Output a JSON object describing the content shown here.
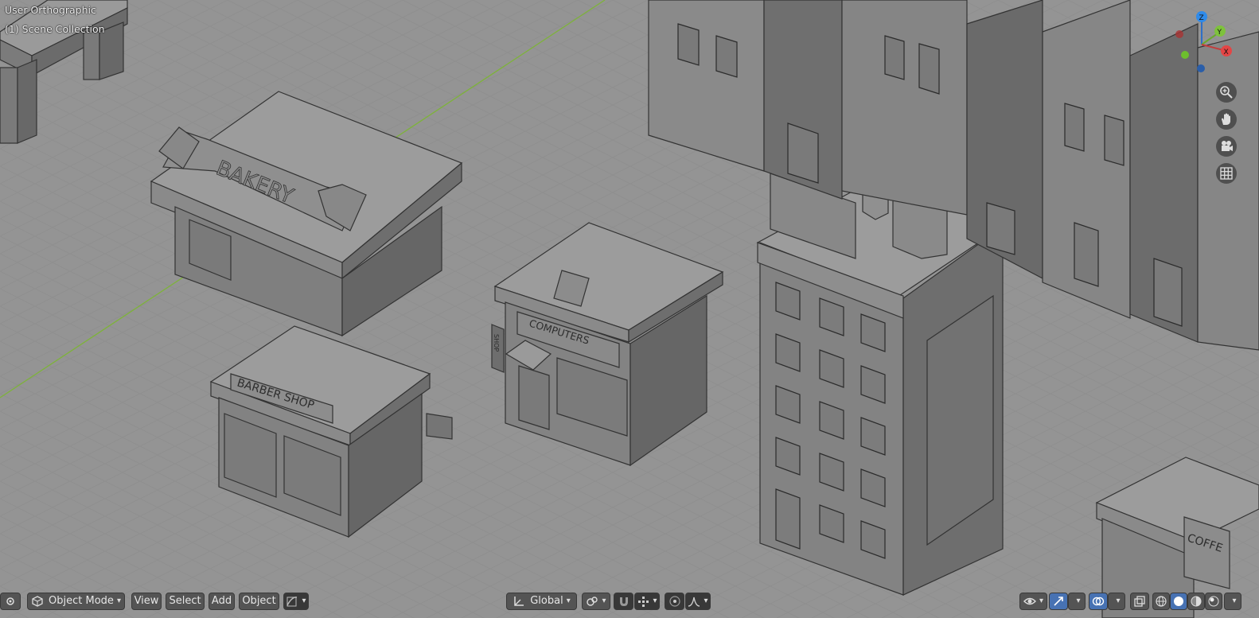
{
  "viewport": {
    "view_name": "User Orthographic",
    "collection": "(1) Scene Collection"
  },
  "scene_labels": {
    "bakery": "BAKERY",
    "barber": "BARBER SHOP",
    "computers": "COMPUTERS",
    "shop_sign": "SHOP",
    "coffee": "COFFE"
  },
  "gizmo": {
    "z": "Z",
    "y": "Y",
    "x": "X"
  },
  "header": {
    "mode": "Object Mode",
    "menu_view": "View",
    "menu_select": "Select",
    "menu_add": "Add",
    "menu_object": "Object",
    "orientation": "Global"
  },
  "colors": {
    "background": "#3d3d3d",
    "grid_line": "#4a4a4a",
    "solid_face_light": "#989898",
    "solid_face_mid": "#7d7d7d",
    "solid_face_dark": "#666666",
    "active_button": "#4772b3",
    "axis_y": "#7eb33a"
  },
  "icons": [
    "editor-type-icon",
    "object-mode-icon",
    "transform-orientation-icon",
    "pivot-icon",
    "snap-icon",
    "proportional-edit-icon",
    "visibility-icon",
    "gizmo-toggle-icon",
    "overlay-icon",
    "xray-icon",
    "wireframe-shading-icon",
    "solid-shading-icon",
    "material-shading-icon",
    "rendered-shading-icon",
    "zoom-icon",
    "hand-pan-icon",
    "camera-icon",
    "grid-ortho-icon"
  ]
}
